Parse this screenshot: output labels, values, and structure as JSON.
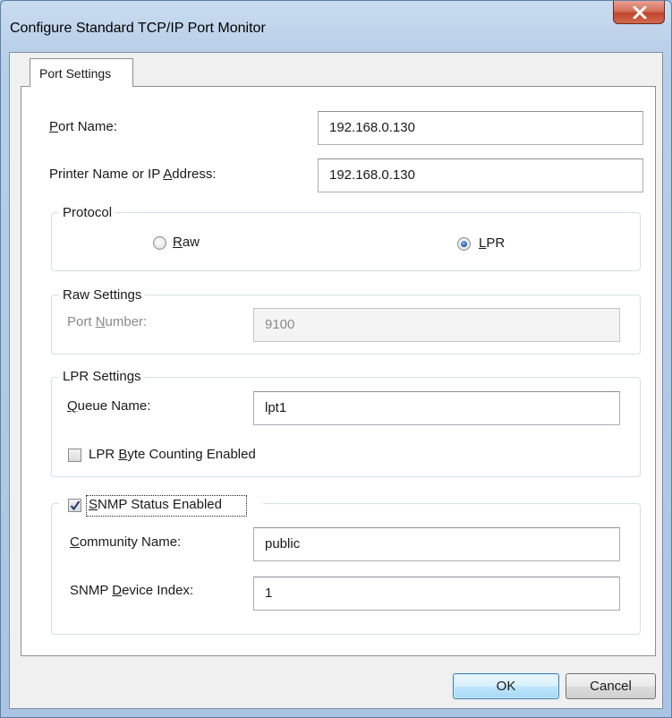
{
  "window": {
    "title": "Configure Standard TCP/IP Port Monitor"
  },
  "tabs": [
    {
      "label": "Port Settings"
    }
  ],
  "port_settings": {
    "port_name": {
      "label_pre": "",
      "label_key": "P",
      "label_post": "ort Name:",
      "value": "192.168.0.130"
    },
    "printer_name": {
      "label_pre": "Printer Name or IP ",
      "label_key": "A",
      "label_post": "ddress:",
      "value": "192.168.0.130"
    },
    "protocol": {
      "title": "Protocol",
      "selected": "LPR",
      "raw": {
        "label_key": "R",
        "label_post": "aw"
      },
      "lpr": {
        "label_key": "L",
        "label_post": "PR"
      }
    },
    "raw_settings": {
      "title": "Raw Settings",
      "port_number": {
        "label_pre": "Port ",
        "label_key": "N",
        "label_post": "umber:",
        "value": "9100"
      }
    },
    "lpr_settings": {
      "title": "LPR Settings",
      "queue_name": {
        "label_pre": "",
        "label_key": "Q",
        "label_post": "ueue Name:",
        "value": "lpt1"
      },
      "byte_counting": {
        "label_pre": "LPR ",
        "label_key": "B",
        "label_post": "yte Counting Enabled",
        "checked": false
      }
    },
    "snmp": {
      "status": {
        "label_pre": "",
        "label_key": "S",
        "label_post": "NMP Status Enabled",
        "checked": true
      },
      "community_name": {
        "label_pre": "",
        "label_key": "C",
        "label_post": "ommunity Name:",
        "value": "public"
      },
      "device_index": {
        "label_pre": "SNMP ",
        "label_key": "D",
        "label_post": "evice Index:",
        "value": "1"
      }
    }
  },
  "buttons": {
    "ok": "OK",
    "cancel": "Cancel"
  },
  "colors": {
    "title_bar": "#b8cfe8",
    "close_button": "#c0452c",
    "default_button_border": "#3c7fb1",
    "radio_dot": "#2b63b0"
  },
  "icons": {
    "close": "close-icon",
    "check": "checkmark-icon"
  }
}
